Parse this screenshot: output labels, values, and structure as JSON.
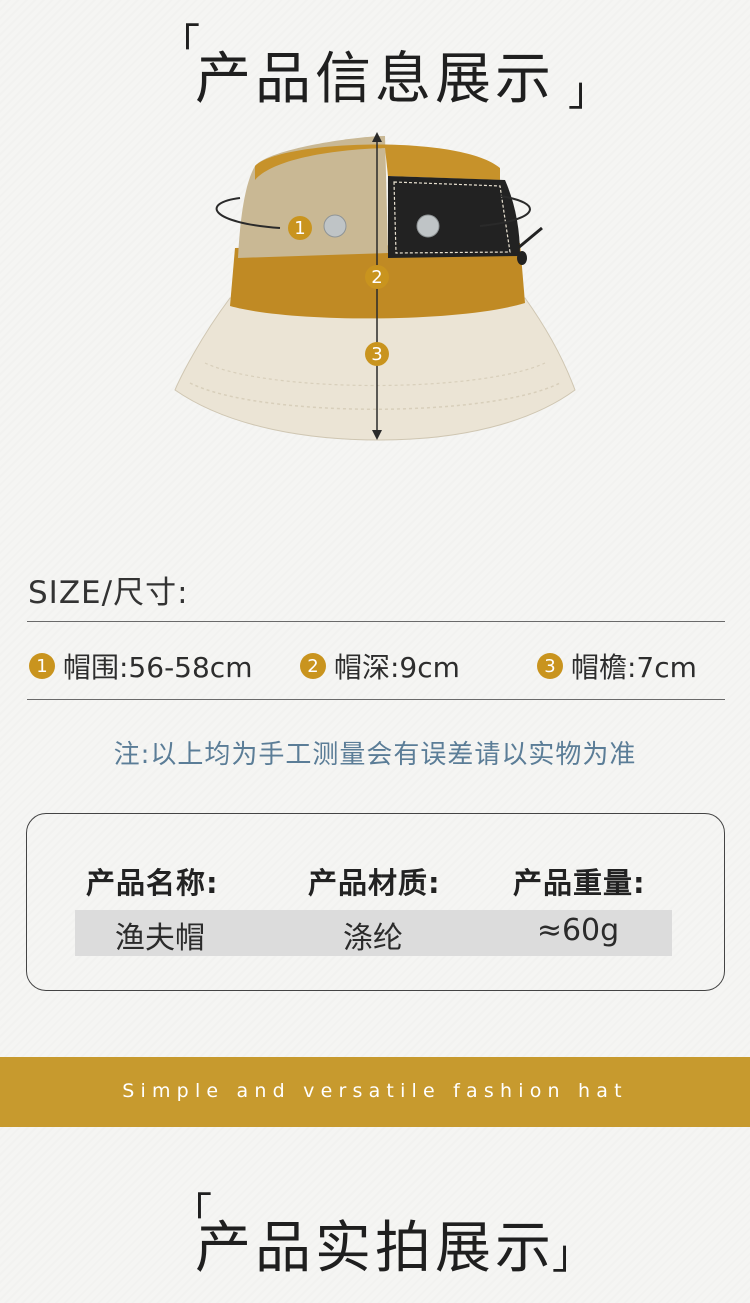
{
  "top_title": {
    "open_bracket": "「",
    "text": "产品信息展示",
    "close_bracket": "」"
  },
  "hat_labels": [
    "1",
    "2",
    "3"
  ],
  "size_section": {
    "title": "SIZE/尺寸:"
  },
  "dimensions": [
    {
      "num": "1",
      "label": "帽围:56-58cm"
    },
    {
      "num": "2",
      "label": "帽深:9cm"
    },
    {
      "num": "3",
      "label": "帽檐:7cm"
    }
  ],
  "note": "注:以上均为手工测量会有误差请以实物为准",
  "product_info": {
    "headers": [
      "产品名称:",
      "产品材质:",
      "产品重量:"
    ],
    "values": [
      "渔夫帽",
      "涤纶",
      "≈60g"
    ]
  },
  "banner": {
    "text": "Simple and versatile fashion hat",
    "color": "#c79a2e"
  },
  "bottom_title": {
    "open_bracket": "「",
    "text": "产品实拍展示",
    "close_bracket": "」"
  },
  "colors": {
    "accent": "#c9941e",
    "note": "#5b7d97"
  }
}
